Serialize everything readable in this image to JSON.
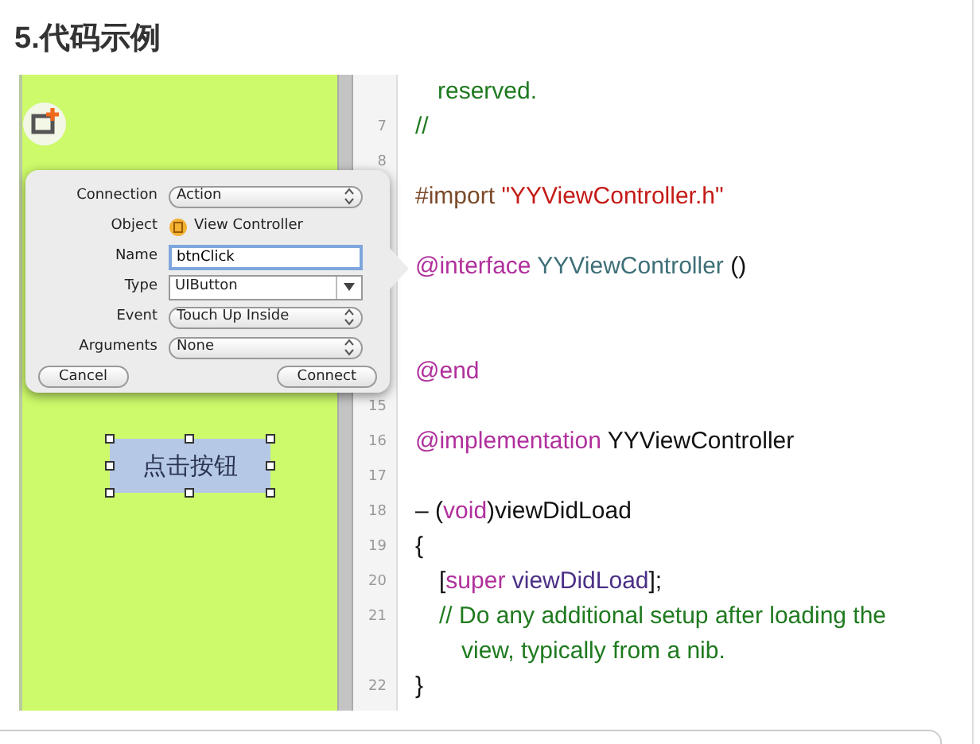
{
  "heading": "5.代码示例",
  "canvas": {
    "button": {
      "label": "点击按钮",
      "selected": true
    }
  },
  "popover": {
    "fields": [
      {
        "label": "Connection",
        "kind": "popup",
        "value": "Action"
      },
      {
        "label": "Object",
        "kind": "object",
        "value": "View Controller"
      },
      {
        "label": "Name",
        "kind": "text",
        "value": "btnClick",
        "focused": true
      },
      {
        "label": "Type",
        "kind": "combo",
        "value": "UIButton"
      },
      {
        "label": "Event",
        "kind": "popup",
        "value": "Touch Up Inside"
      },
      {
        "label": "Arguments",
        "kind": "popup",
        "value": "None"
      }
    ],
    "buttons": [
      "Cancel",
      "Connect"
    ]
  },
  "code": {
    "lines": [
      {
        "kind": "code",
        "wrapped": true,
        "tokens": [
          {
            "text": "reserved.",
            "kind": "comment"
          }
        ]
      },
      {
        "kind": "code",
        "number": "7",
        "tokens": [
          {
            "text": "//",
            "kind": "comment"
          }
        ]
      },
      {
        "kind": "blank",
        "number": "8"
      },
      {
        "kind": "code",
        "tokens": [
          {
            "text": "#import ",
            "kind": "preprocessor"
          },
          {
            "text": "\"YYViewController.h\"",
            "kind": "string"
          }
        ]
      },
      {
        "kind": "blank"
      },
      {
        "kind": "code",
        "tokens": [
          {
            "text": "@interface ",
            "kind": "keyword"
          },
          {
            "text": "YYViewController",
            "kind": "class"
          },
          {
            "text": " ()",
            "kind": "plain"
          }
        ]
      },
      {
        "kind": "blank"
      },
      {
        "kind": "blank"
      },
      {
        "kind": "code",
        "tokens": [
          {
            "text": "@end",
            "kind": "keyword"
          }
        ]
      },
      {
        "kind": "blank",
        "number": "15"
      },
      {
        "kind": "code",
        "number": "16",
        "tokens": [
          {
            "text": "@implementation ",
            "kind": "keyword"
          },
          {
            "text": "YYViewController",
            "kind": "plain"
          }
        ]
      },
      {
        "kind": "blank",
        "number": "17"
      },
      {
        "kind": "code",
        "number": "18",
        "tokens": [
          {
            "text": "– (",
            "kind": "plain"
          },
          {
            "text": "void",
            "kind": "keyword"
          },
          {
            "text": ")viewDidLoad",
            "kind": "plain"
          }
        ]
      },
      {
        "kind": "code",
        "number": "19",
        "tokens": [
          {
            "text": "{",
            "kind": "plain"
          }
        ]
      },
      {
        "kind": "code",
        "number": "20",
        "indented": true,
        "tokens": [
          {
            "text": "[",
            "kind": "plain"
          },
          {
            "text": "super",
            "kind": "keyword"
          },
          {
            "text": " viewDidLoad",
            "kind": "method"
          },
          {
            "text": "];",
            "kind": "plain"
          }
        ]
      },
      {
        "kind": "code",
        "number": "21",
        "indented": true,
        "tokens": [
          {
            "text": "// Do any additional setup after loading the",
            "kind": "comment"
          }
        ]
      },
      {
        "kind": "code",
        "indented": true,
        "wrapped": true,
        "tokens": [
          {
            "text": "view, typically from a nib.",
            "kind": "comment"
          }
        ]
      },
      {
        "kind": "code",
        "number": "22",
        "tokens": [
          {
            "text": "}",
            "kind": "plain"
          }
        ]
      }
    ]
  }
}
